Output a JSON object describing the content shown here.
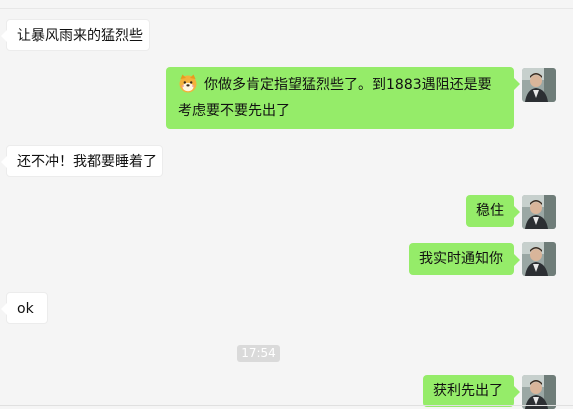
{
  "messages": [
    {
      "side": "in",
      "text": "让暴风雨来的猛烈些"
    },
    {
      "side": "out",
      "text": "你做多肯定指望猛烈些了。到1883遇阻还是要考虑要不要先出了",
      "emoji": "dog-face-icon"
    },
    {
      "side": "in",
      "text": "还不冲！我都要睡着了"
    },
    {
      "side": "out",
      "text": "稳住"
    },
    {
      "side": "out",
      "text": "我实时通知你"
    },
    {
      "side": "in",
      "text": "ok"
    },
    {
      "side": "out",
      "text": "获利先出了"
    }
  ],
  "time_divider": "17:54",
  "colors": {
    "background": "#f5f5f5",
    "incoming_bubble": "#ffffff",
    "outgoing_bubble": "#95ec69",
    "timestamp_bg": "#dadada"
  }
}
